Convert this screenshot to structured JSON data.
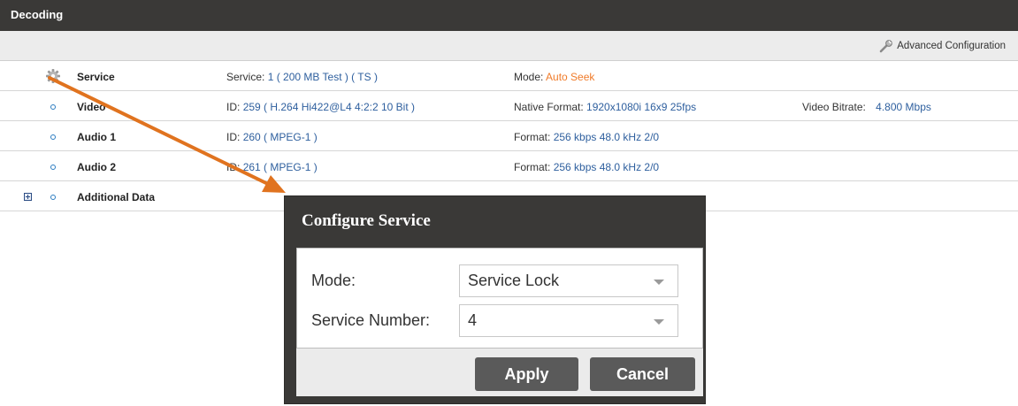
{
  "panel": {
    "title": "Decoding"
  },
  "toolbar": {
    "advanced_config_label": "Advanced Configuration",
    "advanced_config_icon": "wrench-icon"
  },
  "rows": [
    {
      "name": "Service",
      "icon": "gear-icon",
      "col1_label": "Service:",
      "col1_value": "1 ( 200 MB Test ) ( TS )",
      "col2_label": "Mode:",
      "col2_value": "Auto Seek"
    },
    {
      "name": "Video",
      "col1_label": "ID:",
      "col1_value": "259 ( H.264  Hi422@L4  4:2:2 10 Bit )",
      "col2_label": "Native Format:",
      "col2_value": "1920x1080i 16x9 25fps",
      "col3_label": "Video Bitrate:",
      "col3_value": "4.800  Mbps"
    },
    {
      "name": "Audio 1",
      "col1_label": "ID:",
      "col1_value": "260 ( MPEG-1 )",
      "col2_label": "Format:",
      "col2_value": "256 kbps 48.0 kHz  2/0"
    },
    {
      "name": "Audio 2",
      "col1_label": "ID:",
      "col1_value": "261 ( MPEG-1 )",
      "col2_label": "Format:",
      "col2_value": "256 kbps 48.0 kHz  2/0"
    },
    {
      "name": "Additional Data"
    }
  ],
  "dialog": {
    "title": "Configure Service",
    "mode_label": "Mode:",
    "mode_value": "Service Lock",
    "service_number_label": "Service Number:",
    "service_number_value": "4",
    "apply_label": "Apply",
    "cancel_label": "Cancel"
  },
  "colors": {
    "header_bg": "#3a3937",
    "value_blue": "#2e5f9e",
    "mode_orange": "#f07b2a",
    "annotation_arrow": "#e0731f",
    "button_bg": "#5a5a5a"
  }
}
